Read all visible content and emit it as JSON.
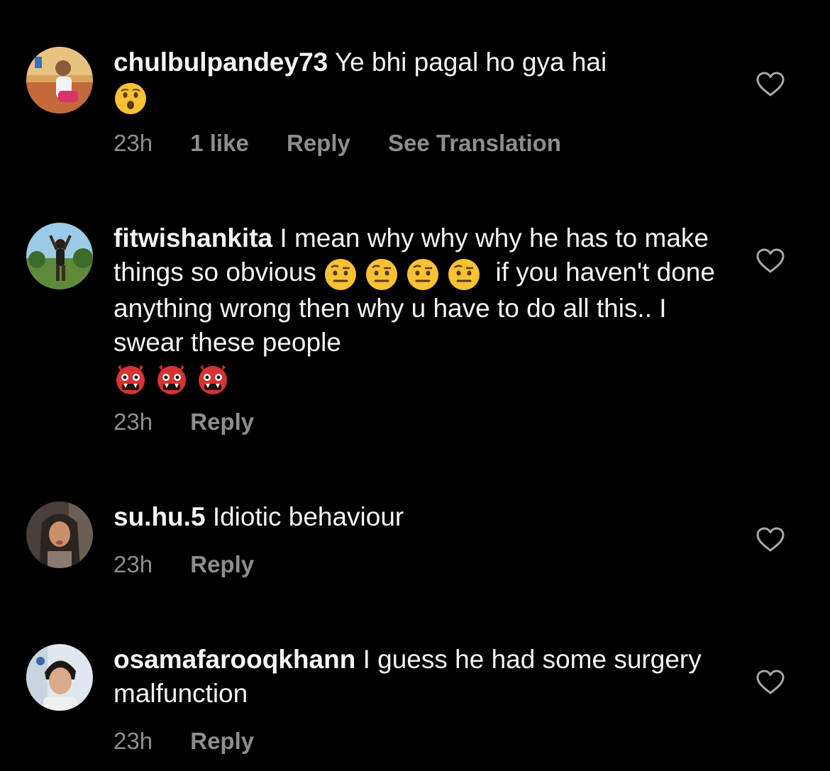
{
  "comments": [
    {
      "username": "chulbulpandey73",
      "text": "Ye bhi pagal ho gya hai",
      "emoji_after": [
        "hushed-face-emoji"
      ],
      "time": "23h",
      "likes": "1 like",
      "reply": "Reply",
      "translate": "See Translation"
    },
    {
      "username": "fitwishankita",
      "text_part1": "I mean why why why he has to make things so obvious",
      "text_part2": "if you haven't done anything wrong then why u have to do all this.. I swear these people",
      "emoji_mid": [
        "raised-eyebrow-emoji",
        "raised-eyebrow-emoji",
        "raised-eyebrow-emoji",
        "raised-eyebrow-emoji"
      ],
      "emoji_after": [
        "ogre-emoji",
        "ogre-emoji",
        "ogre-emoji"
      ],
      "time": "23h",
      "reply": "Reply"
    },
    {
      "username": "su.hu.5",
      "text": "Idiotic behaviour",
      "time": "23h",
      "reply": "Reply"
    },
    {
      "username": "osamafarooqkhann",
      "text": "I guess he had some surgery malfunction",
      "time": "23h",
      "reply": "Reply"
    }
  ],
  "colors": {
    "background": "#000000",
    "primary_text": "#f5f5f5",
    "secondary_text": "#8e8e8e"
  }
}
